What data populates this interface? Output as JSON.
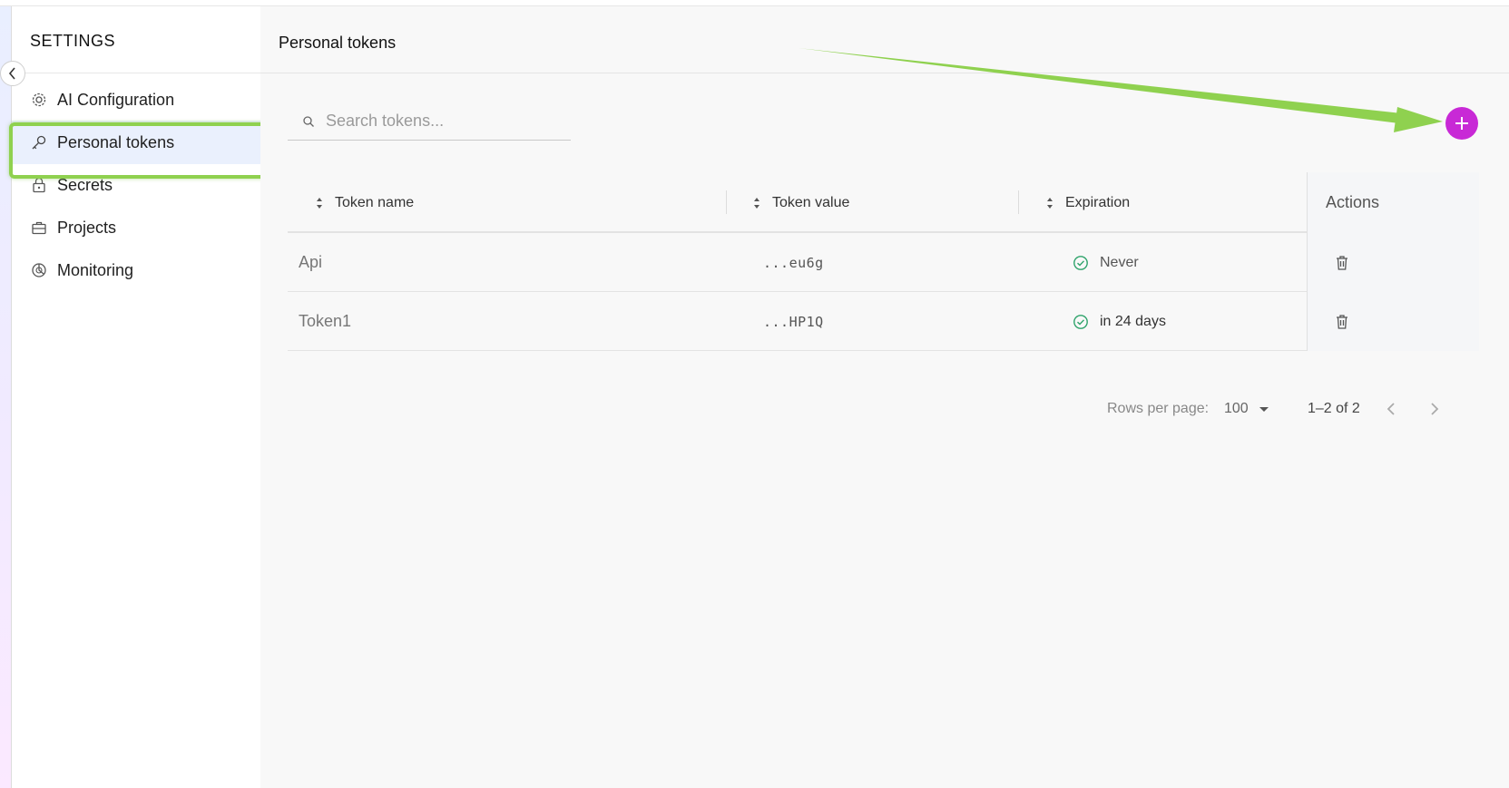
{
  "sidebar": {
    "title": "SETTINGS",
    "items": [
      {
        "label": "AI Configuration",
        "icon": "gear-icon"
      },
      {
        "label": "Personal tokens",
        "icon": "key-icon",
        "active": true
      },
      {
        "label": "Secrets",
        "icon": "lock-icon"
      },
      {
        "label": "Projects",
        "icon": "briefcase-icon"
      },
      {
        "label": "Monitoring",
        "icon": "monitoring-icon"
      }
    ]
  },
  "main": {
    "title": "Personal tokens",
    "search": {
      "placeholder": "Search tokens...",
      "value": ""
    },
    "add_button_color": "#c829d6",
    "table": {
      "columns": [
        "Token name",
        "Token value",
        "Expiration",
        "Actions"
      ],
      "rows": [
        {
          "name": "Api",
          "value": "...eu6g",
          "expiration": "Never"
        },
        {
          "name": "Token1",
          "value": "...HP1Q",
          "expiration": "in 24 days"
        }
      ]
    },
    "pagination": {
      "rows_per_page_label": "Rows per page:",
      "rows_per_page": "100",
      "range": "1–2 of 2"
    }
  },
  "annotation_color": "#8fd14f"
}
